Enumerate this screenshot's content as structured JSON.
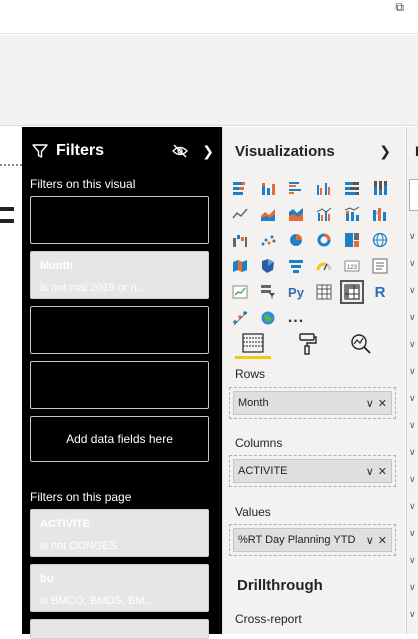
{
  "filters": {
    "title": "Filters",
    "visual_section_label": "Filters on this visual",
    "page_section_label": "Filters on this page",
    "add_fields_label": "Add data fields here",
    "visual_cards": [
      {
        "name": "",
        "condition": ""
      },
      {
        "name": "Month",
        "condition": "is not mai 2019 or n..."
      },
      {
        "name": "",
        "condition": ""
      },
      {
        "name": "",
        "condition": ""
      }
    ],
    "page_cards": [
      {
        "name": "ACTIVITE",
        "condition": "is not CONGES"
      },
      {
        "name": "bu",
        "condition": "is BMCO, BMDS, BM..."
      }
    ]
  },
  "visualizations": {
    "title": "Visualizations",
    "more_label": "...",
    "rows_label": "Rows",
    "rows_field": "Month",
    "columns_label": "Columns",
    "columns_field": "ACTIVITE",
    "values_label": "Values",
    "values_field": "%RT Day Planning YTD",
    "drillthrough_label": "Drillthrough",
    "cross_report_label": "Cross-report",
    "python_label": "Py",
    "r_label": "R"
  },
  "colors": {
    "filters_bg": "#000000",
    "pane_bg": "#f3f2f1",
    "active_tab": "#f2c811",
    "accent": "#1e7fc6"
  }
}
